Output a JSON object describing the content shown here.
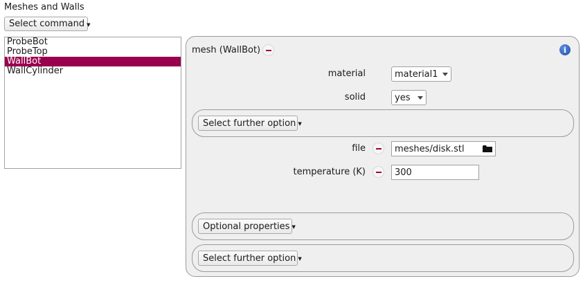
{
  "section_title": "Meshes and Walls",
  "select_command_label": "Select command",
  "items": [
    "ProbeBot",
    "ProbeTop",
    "WallBot",
    "WallCylinder"
  ],
  "selected_index": 2,
  "colors": {
    "selection": "#99004d",
    "remove_icon": "#a0003f",
    "info_icon": "#2a5db0"
  },
  "panel": {
    "title": "mesh (WallBot)",
    "material": {
      "label": "material",
      "value": "material1"
    },
    "solid": {
      "label": "solid",
      "value": "yes"
    },
    "further_option_1": "Select further option",
    "file": {
      "label": "file",
      "value": "meshes/disk.stl"
    },
    "temperature": {
      "label": "temperature (K)",
      "value": "300"
    },
    "optional_properties": "Optional properties",
    "further_option_2": "Select further option"
  }
}
